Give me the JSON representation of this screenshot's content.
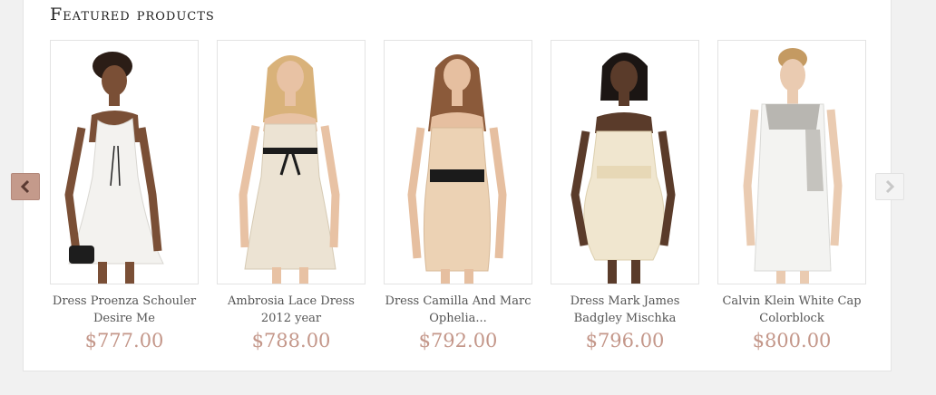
{
  "section": {
    "title": "Featured products"
  },
  "carousel": {
    "prev_icon": "chevron-left-icon",
    "next_icon": "chevron-right-icon"
  },
  "colors": {
    "price": "#c4978a",
    "prev_button": "#c49a8b",
    "next_button": "#f4f4f4"
  },
  "products": [
    {
      "name_line1": "Dress Proenza Schouler",
      "name_line2": "Desire Me",
      "price": "$777.00",
      "image": "white dress with black belt, model holding clutch"
    },
    {
      "name_line1": "Ambrosia Lace Dress",
      "name_line2": "2012 year",
      "price": "$788.00",
      "image": "cream lace strapless dress with black bow"
    },
    {
      "name_line1": "Dress Camilla And Marc",
      "name_line2": "Ophelia...",
      "price": "$792.00",
      "image": "beige strapless dress with black waistband"
    },
    {
      "name_line1": "Dress Mark James",
      "name_line2": "Badgley Mischka",
      "price": "$796.00",
      "image": "ivory strapless bubble dress"
    },
    {
      "name_line1": "Calvin Klein White Cap",
      "name_line2": "Colorblock",
      "price": "$800.00",
      "image": "white sleeveless dress with grey panels"
    }
  ]
}
